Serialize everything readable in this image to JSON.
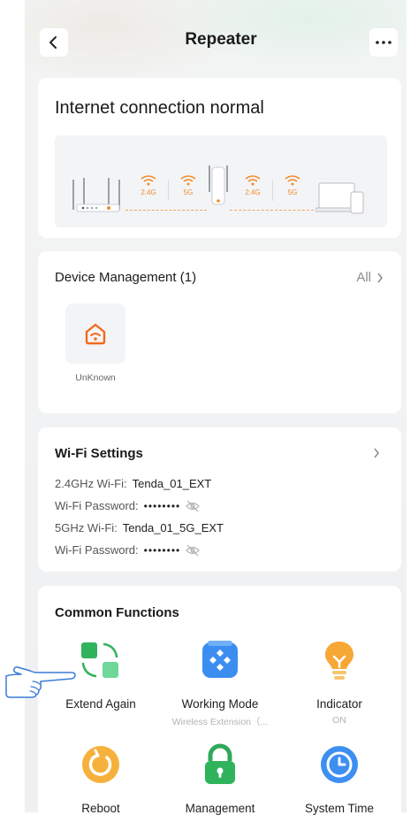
{
  "header": {
    "title": "Repeater",
    "back_icon": "chevron-left-icon",
    "more_icon": "more-dots-icon"
  },
  "status": {
    "title": "Internet connection normal",
    "diagram": {
      "bands": [
        "2.4G",
        "5G",
        "2.4G",
        "5G"
      ]
    }
  },
  "devices": {
    "title": "Device Management (1)",
    "all_label": "All",
    "items": [
      {
        "name": "UnKnown",
        "icon": "home-wifi-icon",
        "color": "#f26b1d"
      }
    ]
  },
  "wifi": {
    "title": "Wi-Fi Settings",
    "rows": [
      {
        "label": "2.4GHz Wi-Fi:",
        "value": "Tenda_01_EXT"
      },
      {
        "label": "Wi-Fi Password:",
        "value": "••••••••",
        "icon": "eye-off-icon"
      },
      {
        "label": "5GHz Wi-Fi:",
        "value": "Tenda_01_5G_EXT"
      },
      {
        "label": "Wi-Fi Password:",
        "value": "••••••••",
        "icon": "eye-off-icon"
      }
    ]
  },
  "functions": {
    "title": "Common Functions",
    "items": [
      {
        "label": "Extend Again",
        "sub": "",
        "icon": "extend-again-icon"
      },
      {
        "label": "Working Mode",
        "sub": "Wireless Extension（...",
        "icon": "working-mode-icon"
      },
      {
        "label": "Indicator",
        "sub": "ON",
        "icon": "bulb-icon"
      },
      {
        "label": "Reboot",
        "sub": "",
        "icon": "reboot-icon"
      },
      {
        "label": "Management",
        "sub": "",
        "icon": "lock-icon"
      },
      {
        "label": "System Time",
        "sub": "",
        "icon": "clock-icon"
      }
    ]
  },
  "overlay": {
    "icon": "pointing-hand-icon"
  }
}
